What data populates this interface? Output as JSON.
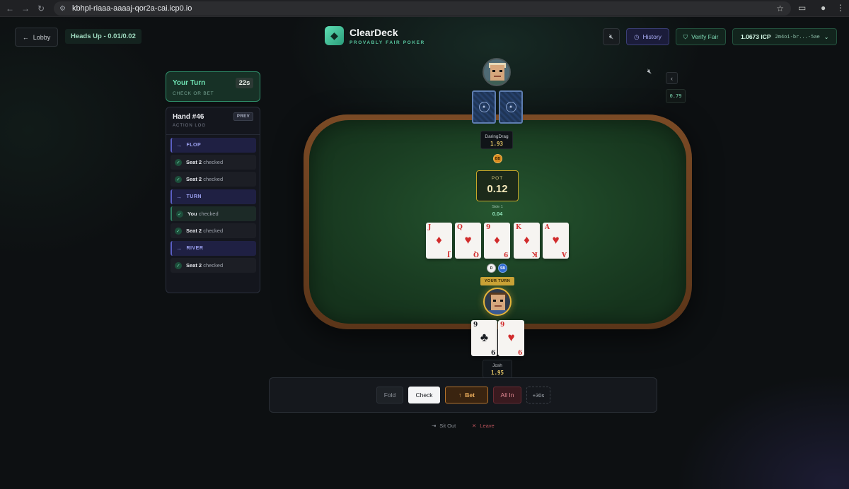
{
  "browser": {
    "url": "kbhpl-riaaa-aaaaj-qor2a-cai.icp0.io"
  },
  "header": {
    "lobby_label": "Lobby",
    "stakes_label": "Heads Up - 0.01/0.02",
    "brand_name": "ClearDeck",
    "brand_tagline": "PROVABLY FAIR POKER",
    "history_label": "History",
    "verify_label": "Verify Fair",
    "balance": "1.0673 ICP",
    "address": "2m4oi-br...-5ae"
  },
  "turn_panel": {
    "title": "Your Turn",
    "subtitle": "CHECK OR BET",
    "timer": "22s"
  },
  "action_log": {
    "title": "Hand #46",
    "subtitle": "ACTION LOG",
    "prev_label": "PREV",
    "entries": [
      {
        "type": "street",
        "label": "FLOP"
      },
      {
        "type": "action",
        "who": "Seat 2",
        "action": "checked"
      },
      {
        "type": "action",
        "who": "Seat 2",
        "action": "checked"
      },
      {
        "type": "street",
        "label": "TURN"
      },
      {
        "type": "action",
        "who": "You",
        "action": "checked"
      },
      {
        "type": "action",
        "who": "Seat 2",
        "action": "checked"
      },
      {
        "type": "street",
        "label": "RIVER"
      },
      {
        "type": "action",
        "who": "Seat 2",
        "action": "checked"
      }
    ]
  },
  "side_widgets": {
    "ping": "0.79"
  },
  "table": {
    "opponent": {
      "name": "DaringDrag",
      "stack": "1.93",
      "blind_chip": "BB"
    },
    "pot_label": "POT",
    "pot_value": "0.12",
    "side_label": "Side 1",
    "side_value": "0.04",
    "board": [
      {
        "rank": "J",
        "suit": "♦",
        "color": "red"
      },
      {
        "rank": "Q",
        "suit": "♥",
        "color": "red"
      },
      {
        "rank": "9",
        "suit": "♦",
        "color": "red"
      },
      {
        "rank": "K",
        "suit": "♦",
        "color": "red"
      },
      {
        "rank": "A",
        "suit": "♥",
        "color": "red"
      }
    ],
    "dealer_chip": "D",
    "sb_chip": "SB",
    "your_turn_tag": "YOUR TURN",
    "hero": {
      "name": "Josh",
      "stack": "1.95",
      "cards": [
        {
          "rank": "9",
          "suit": "♣",
          "color": "black"
        },
        {
          "rank": "9",
          "suit": "♥",
          "color": "red"
        }
      ]
    }
  },
  "actions": {
    "fold": "Fold",
    "check": "Check",
    "bet": "Bet",
    "allin": "All In",
    "extend": "+30s"
  },
  "footer": {
    "sit_out": "Sit Out",
    "leave": "Leave"
  },
  "colors": {
    "accent": "#5fdfb4",
    "felt": "#1a3d22",
    "rail": "#6b3f1f",
    "pot_border": "#c8a628"
  }
}
